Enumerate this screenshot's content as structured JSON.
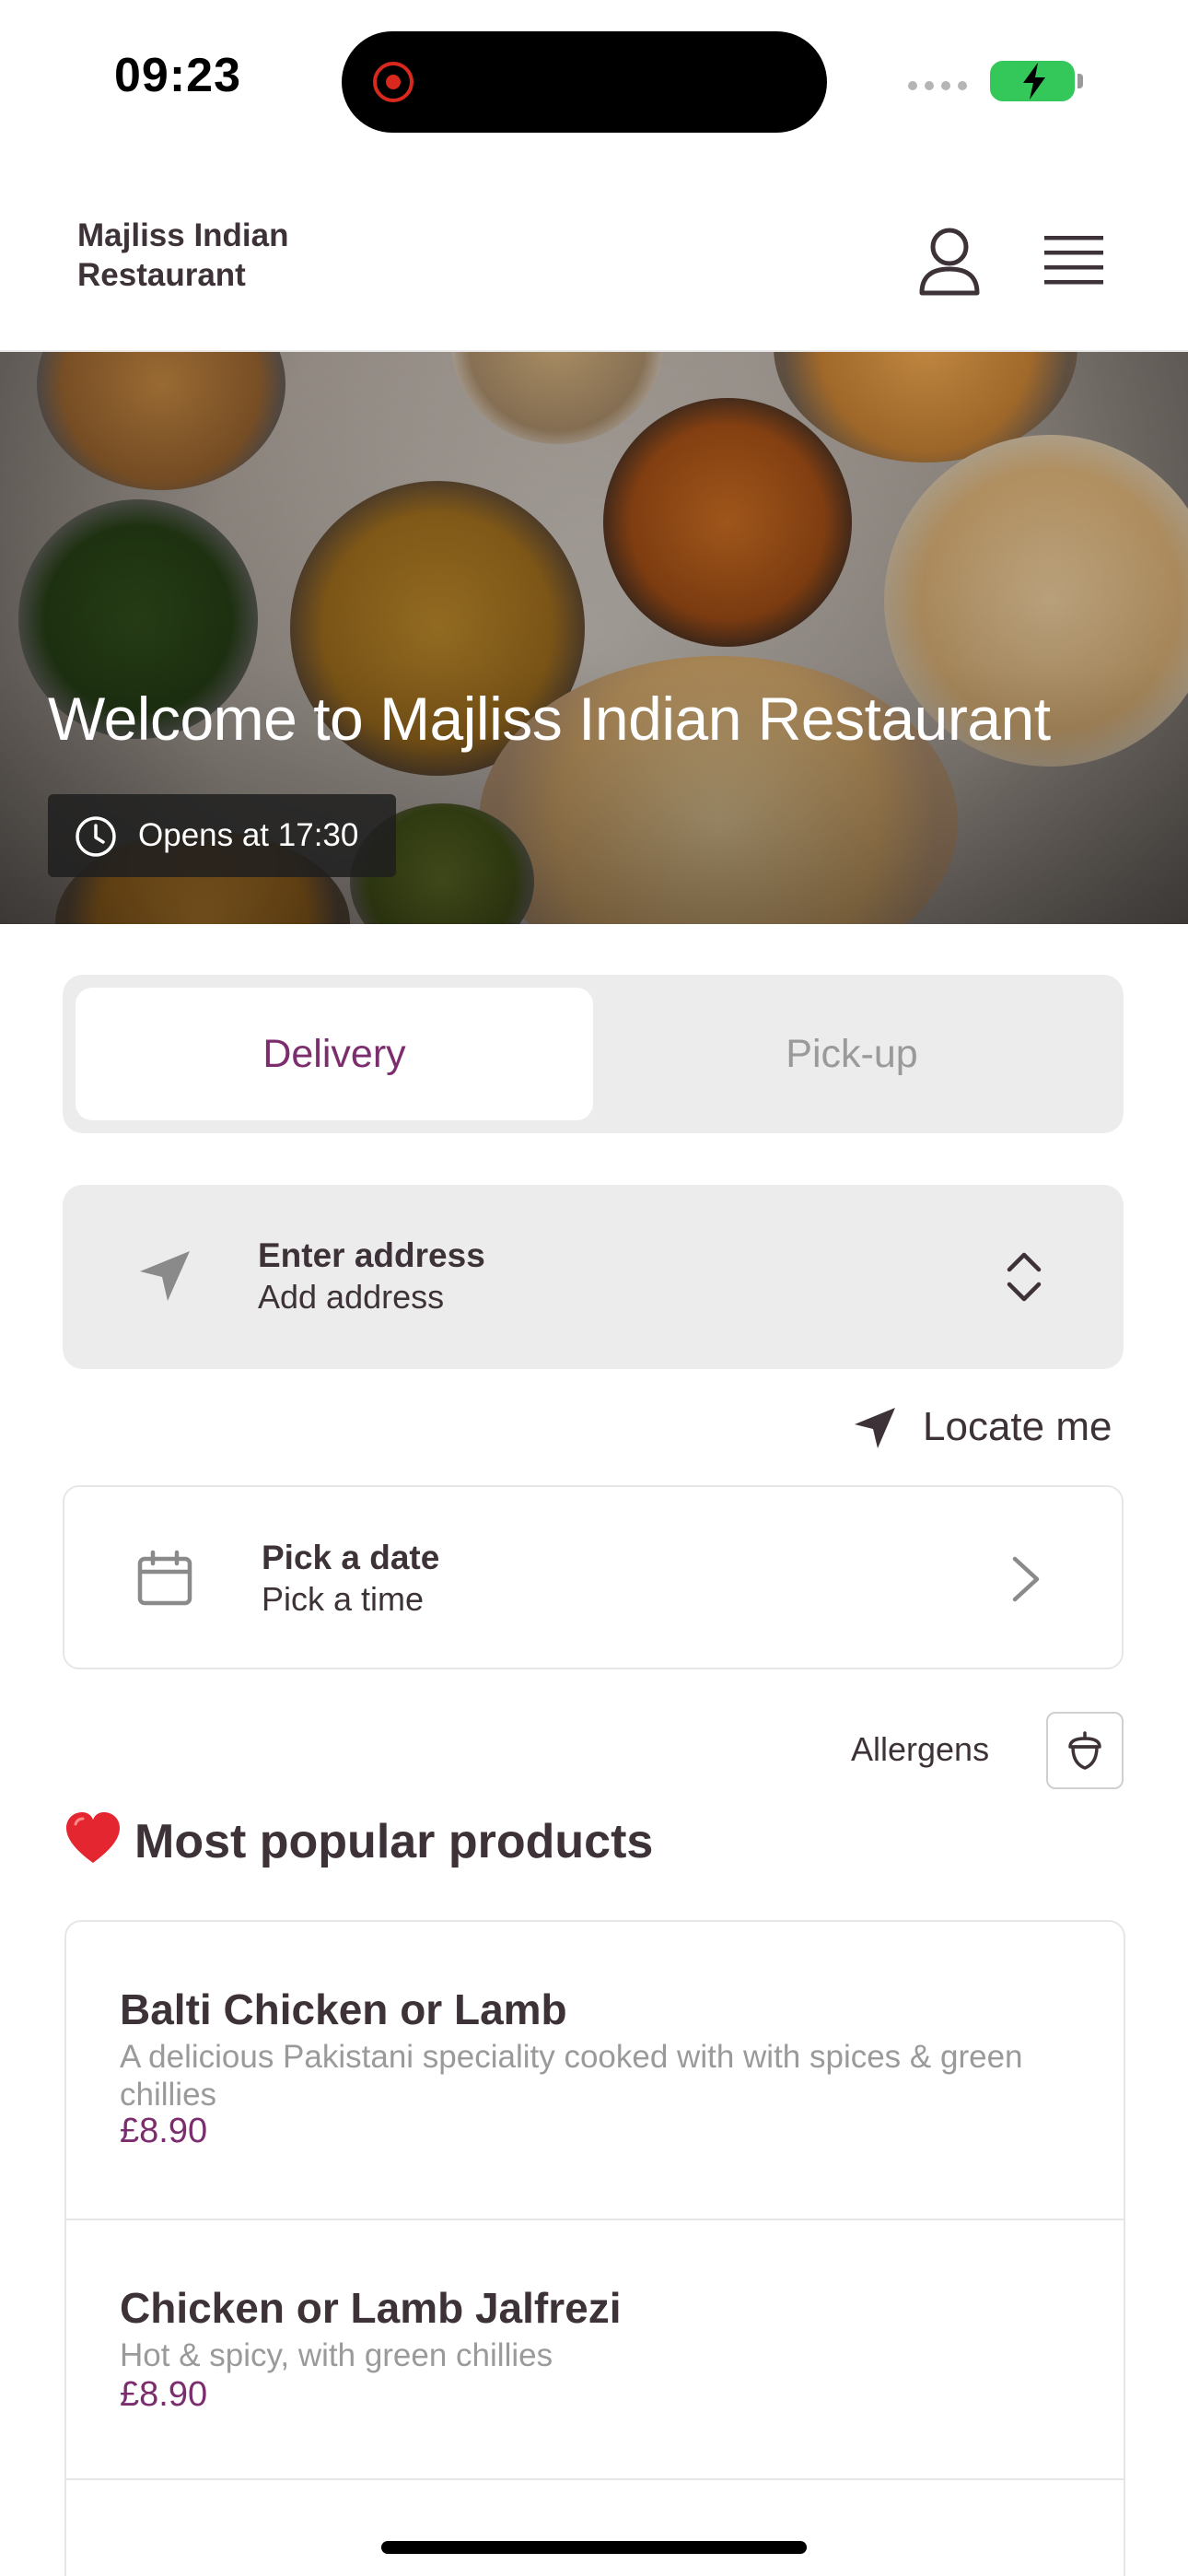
{
  "status_bar": {
    "time": "09:23"
  },
  "header": {
    "brand": "Majliss Indian Restaurant"
  },
  "hero": {
    "title": "Welcome to Majliss Indian Restaurant",
    "hours": "Opens at 17:30"
  },
  "order_mode": {
    "tabs": [
      "Delivery",
      "Pick-up"
    ],
    "selected": "Delivery"
  },
  "address": {
    "title": "Enter address",
    "subtitle": "Add address"
  },
  "locate": {
    "label": "Locate me"
  },
  "schedule": {
    "title": "Pick a date",
    "subtitle": "Pick a time"
  },
  "allergens": {
    "label": "Allergens"
  },
  "popular": {
    "title": "Most popular products",
    "products": [
      {
        "name": "Balti Chicken or Lamb",
        "description": "A delicious Pakistani speciality cooked with with spices & green chillies",
        "price": "£8.90"
      },
      {
        "name": "Chicken or Lamb Jalfrezi",
        "description": "Hot & spicy, with green chillies",
        "price": "£8.90"
      }
    ]
  },
  "colors": {
    "accent": "#7b2d6e",
    "text": "#3d3238",
    "muted": "#9a9a9a",
    "panel": "#ececec"
  }
}
